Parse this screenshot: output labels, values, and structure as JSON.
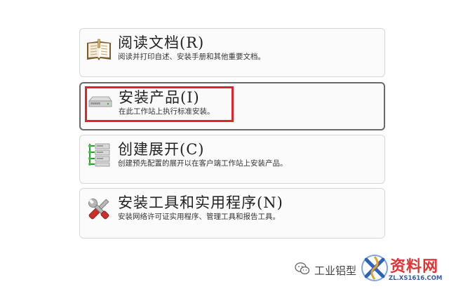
{
  "menu": {
    "items": [
      {
        "title": "阅读文档(R)",
        "description": "阅读并打印自述、安装手册和其他重要文档。",
        "icon": "book-icon"
      },
      {
        "title": "安装产品(I)",
        "description": "在此工作站上执行标准安装。",
        "icon": "drive-icon",
        "selected": true
      },
      {
        "title": "创建展开(C)",
        "description": "创建预先配置的展开以在客户端工作站上安装产品。",
        "icon": "network-deploy-icon"
      },
      {
        "title": "安装工具和实用程序(N)",
        "description": "安装网络许可证实用程序、管理工具和报告工具。",
        "icon": "tools-icon"
      }
    ]
  },
  "watermark": {
    "text": "工业铝型",
    "icon": "wechat-icon"
  },
  "logo": {
    "text": "资料网",
    "url": "ZL.XS1616.COM"
  },
  "colors": {
    "highlight": "#e2222b",
    "selected_border": "#6a6a6a",
    "logo_red": "#e23434"
  }
}
